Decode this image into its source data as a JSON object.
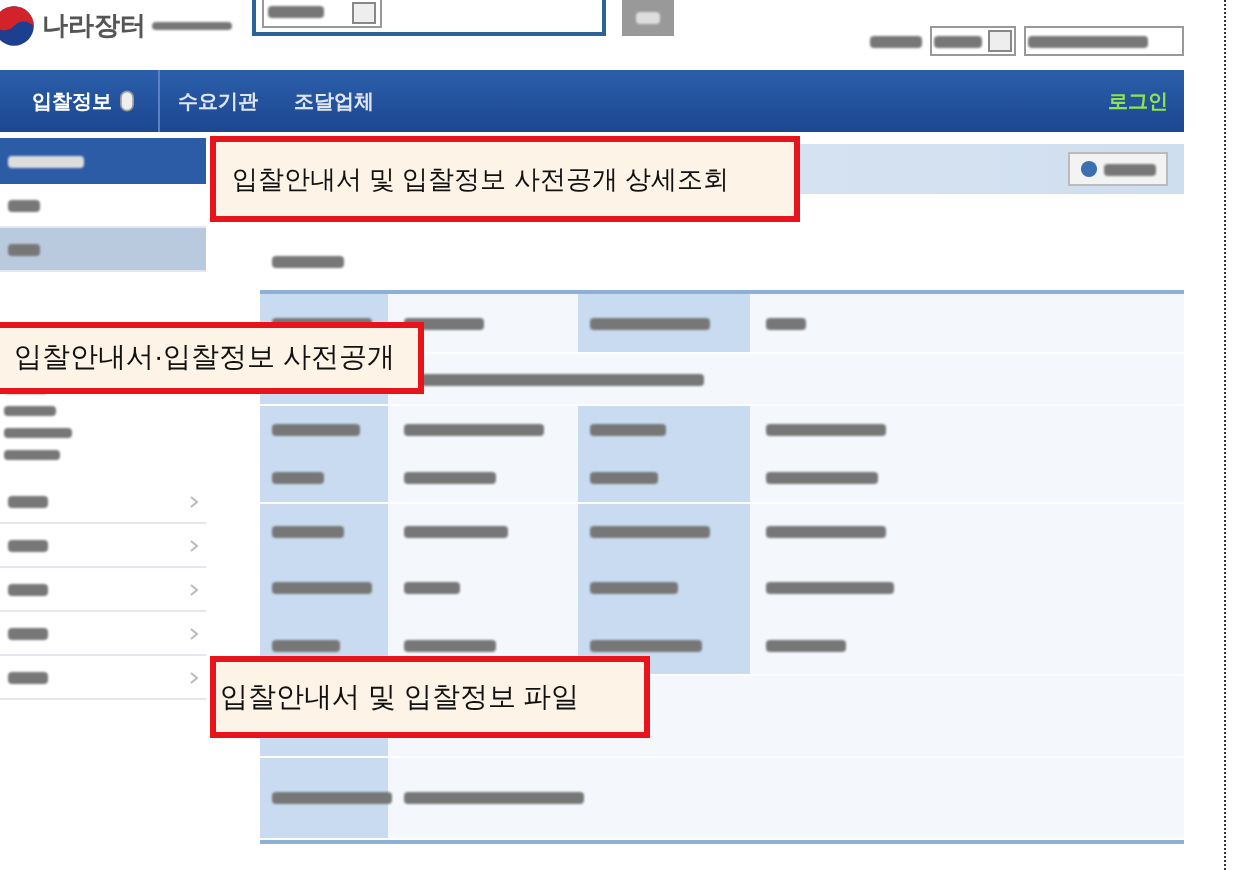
{
  "header": {
    "logo_text": "나라장터"
  },
  "nav": {
    "items": [
      {
        "label": "입찰정보",
        "selected": true
      },
      {
        "label": "수요기관",
        "selected": false
      },
      {
        "label": "조달업체",
        "selected": false
      }
    ],
    "login": "로그인"
  },
  "sidebar": {
    "items": [
      {
        "selected": false
      },
      {
        "selected": true
      }
    ]
  },
  "callouts": [
    {
      "kind": "title",
      "text": "입찰안내서 및 입찰정보 사전공개 상세조회"
    },
    {
      "kind": "menu",
      "text": "입찰안내서·입찰정보 사전공개"
    },
    {
      "kind": "files",
      "text": "입찰안내서 및 입찰정보 파일"
    }
  ]
}
